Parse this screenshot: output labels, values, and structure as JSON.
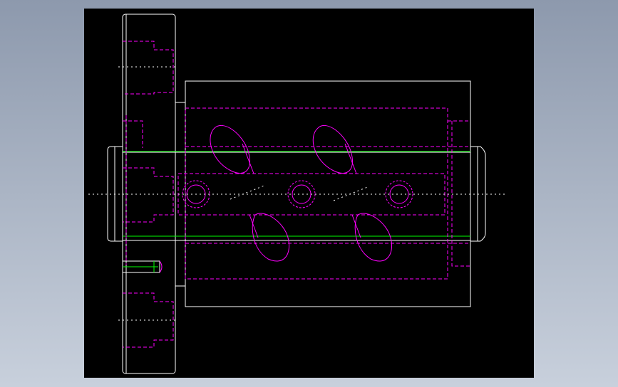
{
  "viewer": {
    "background": "#000000",
    "frame_gradient": [
      "#8d99ad",
      "#c8d0dc"
    ]
  },
  "drawing": {
    "colors": {
      "outline": "#ffffff",
      "hidden": "#ff00ff",
      "thread": "#00ff00",
      "centerline": "#ffffff"
    },
    "components": [
      "flange",
      "nut-body",
      "screw-shaft",
      "return-tubes",
      "balls"
    ]
  }
}
